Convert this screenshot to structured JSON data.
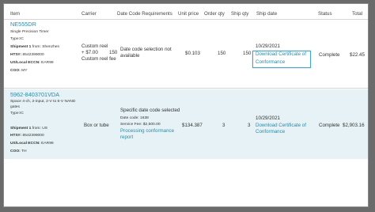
{
  "headers": {
    "item": "Item",
    "carrier": "Carrier",
    "date_code": "Date Code Requirements",
    "unit_price": "Unit price",
    "order_qty": "Order qty",
    "ship_qty": "Ship qty",
    "ship_date": "Ship date",
    "status": "Status",
    "total": "Total"
  },
  "rows": [
    {
      "part_number": "NE555DR",
      "description": "Single Precision Timer",
      "type": "Type:IC",
      "shipment_label": "Shipment 1",
      "shipment_from": " from: Shenzhen",
      "hts_label": "HTS#:",
      "hts_value": " 8542399000",
      "eccn_label": "US/Local ECCN:",
      "eccn_value": " EAR99",
      "coo_label": "COO:",
      "coo_value": " MY",
      "carrier_line1": "Custom reel",
      "carrier_line2": "+ $7.00",
      "carrier_line3": "Custom reel fee",
      "carrier_qty": "150",
      "date_code_line1": "Date code selection not",
      "date_code_line2": "available",
      "unit_price": "$0.103",
      "order_qty": "150",
      "ship_qty": "150",
      "ship_date": "10/29/2021",
      "cert_line1": "Download Certificate of",
      "cert_line2": "Conformance",
      "status": "Complete",
      "total": "$22.45"
    },
    {
      "part_number": "5962-8403701VDA",
      "description_line1": "Space 4-ch, 2-input, 2-V to 6-V NAND",
      "description_line2": "gates",
      "type": "Type:IC",
      "shipment_label": "Shipment 1",
      "shipment_from": " from: US",
      "hts_label": "HTS#:",
      "hts_value": " 8542399000",
      "eccn_label": "US/Local ECCN:",
      "eccn_value": " EAR99",
      "coo_label": "COO:",
      "coo_value": " TH",
      "carrier": "Box or tube",
      "date_code_line1": "Specific date code selected",
      "date_code_detail": "Date code: 1638",
      "service_fee": "Service Fee: $2,500.00",
      "processing_line1": "Processing conformance",
      "processing_line2": "report",
      "unit_price": "$134.387",
      "order_qty": "3",
      "ship_qty": "3",
      "ship_date": "10/29/2021",
      "cert_line1": "Download Certificate of",
      "cert_line2": "Conformance",
      "status": "Complete",
      "total": "$2,903.16"
    }
  ]
}
